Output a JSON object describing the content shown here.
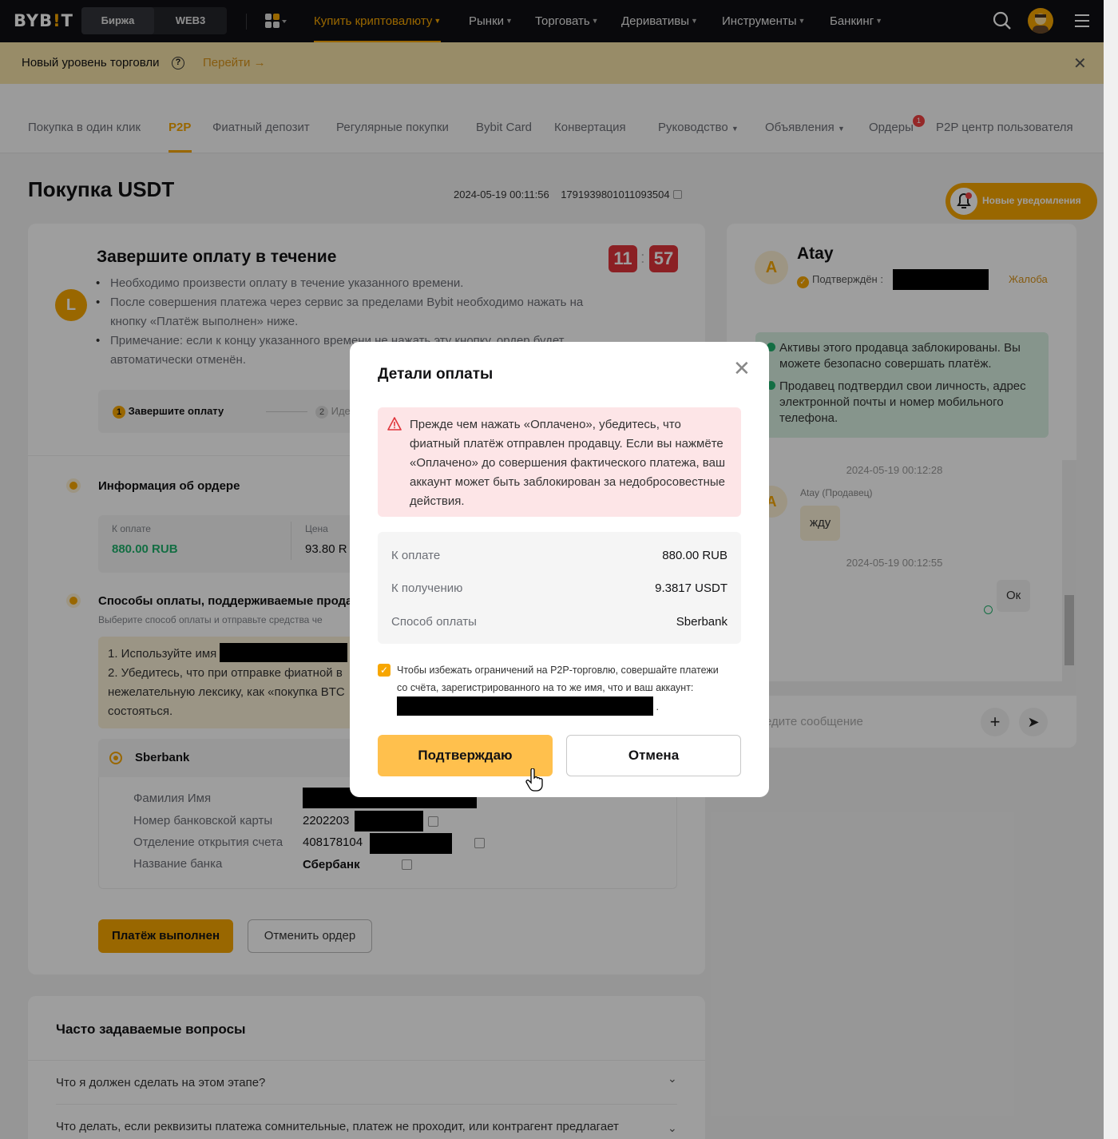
{
  "nav": {
    "logo_a": "BYB",
    "logo_b": "!",
    "logo_c": "T",
    "seg_exchange": "Биржа",
    "seg_web3": "WEB3",
    "items": [
      {
        "label": "Купить криптовалюту",
        "active": true
      },
      {
        "label": "Рынки"
      },
      {
        "label": "Торговать"
      },
      {
        "label": "Деривативы"
      },
      {
        "label": "Инструменты"
      },
      {
        "label": "Банкинг"
      }
    ]
  },
  "banner": {
    "text": "Новый уровень торговли",
    "help": "?",
    "link": "Перейти →",
    "close": "✕"
  },
  "subnav": {
    "items": [
      "Покупка в один клик",
      "P2P",
      "Фиатный депозит",
      "Регулярные покупки",
      "Bybit Card",
      "Конвертация",
      "Руководство",
      "Объявления",
      "Ордеры",
      "P2P центр пользователя"
    ],
    "orders_badge": "1"
  },
  "order": {
    "title": "Покупка USDT",
    "datetime": "2024-05-19 00:11:56",
    "order_id": "1791939801011093504",
    "notif_label": "Новые уведомления",
    "avatar_letter": "L",
    "complete_title": "Завершите оплату в течение",
    "bullets": [
      "Необходимо произвести оплату в течение указанного времени.",
      "После совершения платежа через сервис за пределами Bybit необходимо нажать на кнопку «Платёж выполнен» ниже.",
      "Примечание: если к концу указанного времени не нажать эту кнопку, ордер будет автоматически отменён."
    ],
    "timer_min": "11",
    "timer_sec": "57",
    "timer_sep": ":",
    "step1_num": "1",
    "step1": "Завершите оплату",
    "step2_num": "2",
    "step2": "Иде",
    "info_title": "Информация об ордере",
    "pay_label": "К оплате",
    "pay_value": "880.00 RUB",
    "price_label": "Цена",
    "price_value": "93.80 R",
    "methods_title": "Способы оплаты, поддерживаемые продав",
    "methods_sub": "Выберите способ оплаты и отправьте средства че",
    "warn_line1": "1. Используйте имя",
    "warn_line2": "2. Убедитесь, что при отправке фиатной в нежелательную лексику, как «покупка BTC состояться.",
    "bank_name": "Sberbank",
    "fields": [
      {
        "label": "Фамилия Имя",
        "value": ""
      },
      {
        "label": "Номер банковской карты",
        "value": "2202203"
      },
      {
        "label": "Отделение открытия счета",
        "value": "408178104"
      },
      {
        "label": "Название банка",
        "value": "Сбербанк"
      }
    ],
    "btn_paid": "Платёж выполнен",
    "btn_cancel": "Отменить ордер"
  },
  "seller": {
    "avatar": "A",
    "name": "Atay",
    "verified": "Подтверждён :",
    "complaint": "Жалоба",
    "notes": [
      "Активы этого продавца заблокированы. Вы можете безопасно совершать платёж.",
      "Продавец подтвердил свои личность, адрес электронной почты и номер мобильного телефона."
    ],
    "chat": {
      "ts1": "2024-05-19 00:12:28",
      "sender": "Atay (Продавец)",
      "msg1": "жду",
      "ts2": "2024-05-19 00:12:55",
      "msg2": "Ок",
      "placeholder": "едите сообщение",
      "add": "+",
      "send": "➤"
    }
  },
  "faq": {
    "title": "Часто задаваемые вопросы",
    "q1": "Что я должен сделать на этом этапе?",
    "q2": "Что делать, если реквизиты платежа сомнительные, платеж не проходит, или контрагент предлагает",
    "chevron": "⌄"
  },
  "modal": {
    "title": "Детали оплаты",
    "close": "✕",
    "warning": "Прежде чем нажать «Оплачено», убедитесь, что фиатный платёж отправлен продавцу. Если вы нажмёте «Оплачено» до совершения фактического платежа, ваш аккаунт может быть заблокирован за недобросовестные действия.",
    "rows": [
      {
        "label": "К оплате",
        "value": "880.00 RUB"
      },
      {
        "label": "К получению",
        "value": "9.3817 USDT"
      },
      {
        "label": "Способ оплаты",
        "value": "Sberbank"
      }
    ],
    "check_mark": "✓",
    "checkbox_text": "Чтобы избежать ограничений на P2P-торговлю, совершайте платежи со счёта, зарегистрированного на то же имя, что и ваш аккаунт:",
    "checkbox_tail": ".",
    "confirm": "Подтверждаю",
    "cancel": "Отмена"
  },
  "colors": {
    "accent": "#f7a600",
    "danger": "#e0353b",
    "success": "#20b26c"
  }
}
